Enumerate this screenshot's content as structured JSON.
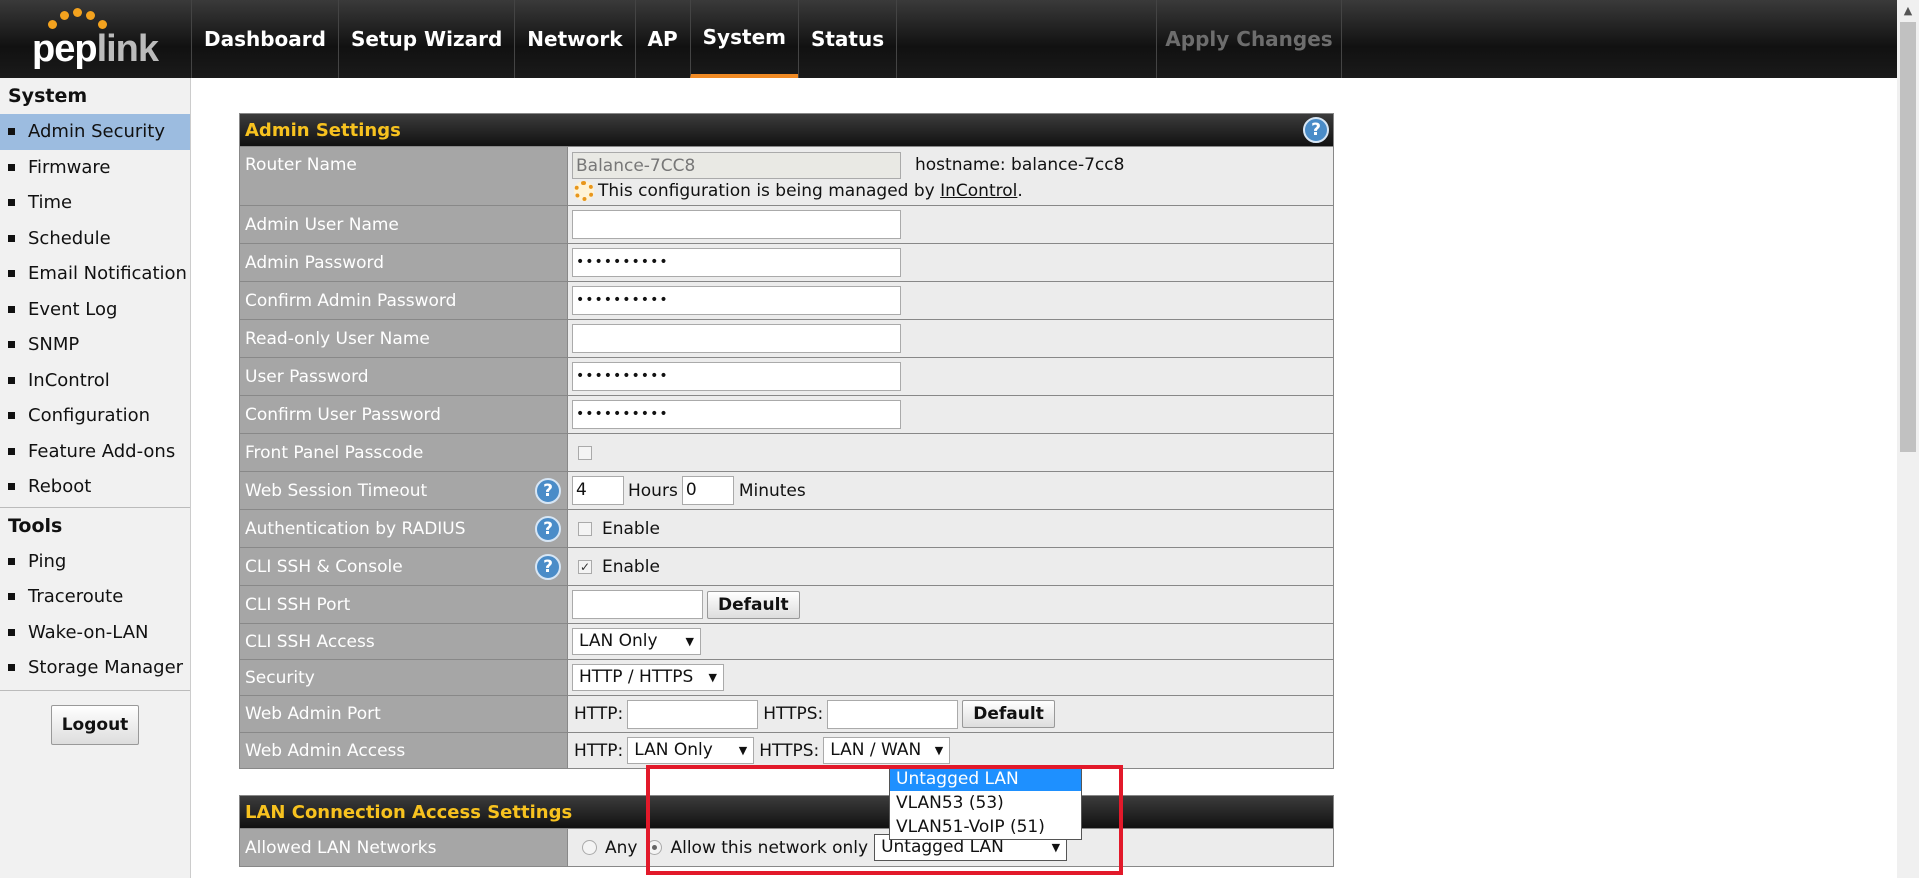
{
  "brand": {
    "logo_pep": "pep",
    "logo_link": "link"
  },
  "nav": {
    "items": [
      "Dashboard",
      "Setup Wizard",
      "Network",
      "AP",
      "System",
      "Status"
    ],
    "active": "System",
    "apply_label": "Apply Changes"
  },
  "sidebar": {
    "system_heading": "System",
    "system_items": [
      "Admin Security",
      "Firmware",
      "Time",
      "Schedule",
      "Email Notification",
      "Event Log",
      "SNMP",
      "InControl",
      "Configuration",
      "Feature Add-ons",
      "Reboot"
    ],
    "active_item": "Admin Security",
    "tools_heading": "Tools",
    "tools_items": [
      "Ping",
      "Traceroute",
      "Wake-on-LAN",
      "Storage Manager"
    ],
    "logout_label": "Logout"
  },
  "admin": {
    "title": "Admin Settings",
    "router_name_label": "Router Name",
    "router_name_value": "Balance-7CC8",
    "hostname_text": "hostname: balance-7cc8",
    "managed_text": "This configuration is being managed by",
    "managed_link": "InControl",
    "managed_tail": ".",
    "admin_user_label": "Admin User Name",
    "admin_user_value": "",
    "admin_pw_label": "Admin Password",
    "admin_pw_value": "••••••••••",
    "confirm_admin_pw_label": "Confirm Admin Password",
    "confirm_admin_pw_value": "••••••••••",
    "ro_user_label": "Read-only User Name",
    "ro_user_value": "",
    "user_pw_label": "User Password",
    "user_pw_value": "••••••••••",
    "confirm_user_pw_label": "Confirm User Password",
    "confirm_user_pw_value": "••••••••••",
    "front_panel_label": "Front Panel Passcode",
    "front_panel_checked": false,
    "session_label": "Web Session Timeout",
    "session_hours": "4",
    "hours_unit": "Hours",
    "session_minutes": "0",
    "minutes_unit": "Minutes",
    "radius_label": "Authentication by RADIUS",
    "radius_enable": "Enable",
    "radius_checked": false,
    "cli_label": "CLI SSH & Console",
    "cli_enable": "Enable",
    "cli_checked": true,
    "cli_port_label": "CLI SSH Port",
    "cli_port_value": "",
    "default_label": "Default",
    "cli_access_label": "CLI SSH Access",
    "cli_access_value": "LAN Only",
    "security_label": "Security",
    "security_value": "HTTP / HTTPS",
    "web_port_label": "Web Admin Port",
    "http_label": "HTTP:",
    "https_label": "HTTPS:",
    "http_port_value": "",
    "https_port_value": "",
    "web_access_label": "Web Admin Access",
    "http_access_value": "LAN Only",
    "https_access_value": "LAN / WAN"
  },
  "lan": {
    "title": "LAN Connection Access Settings",
    "allowed_label": "Allowed LAN Networks",
    "any_label": "Any",
    "allow_only_label": "Allow this network only",
    "selected_network": "Untagged LAN",
    "dropdown_options": [
      "Untagged LAN",
      "VLAN53 (53)",
      "VLAN51-VoIP (51)"
    ]
  },
  "colors": {
    "accent": "#f08a24",
    "section_title": "#f7c21f",
    "sidebar_active": "#9cbce0",
    "highlight": "#e2192a"
  }
}
